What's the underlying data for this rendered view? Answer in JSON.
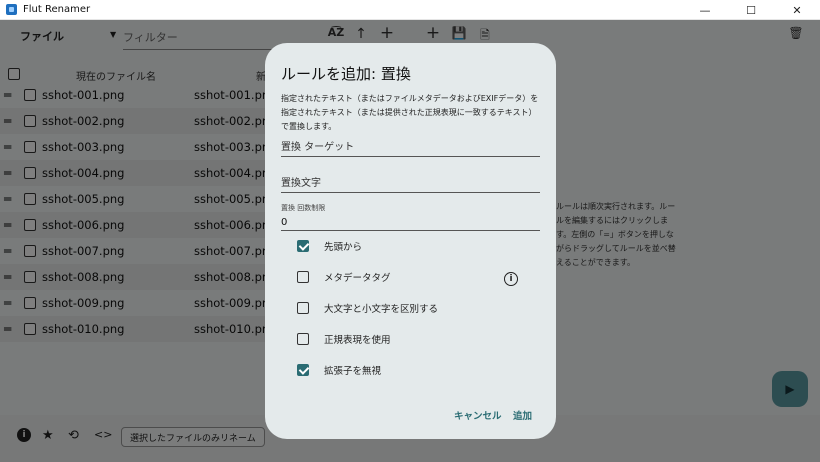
{
  "window": {
    "title": "Flut Renamer",
    "minimize": "—",
    "maximize": "☐",
    "close": "✕"
  },
  "toolbar": {
    "file_select": "ファイル",
    "filter_placeholder": "フィルター",
    "sort_az": "A͡Z",
    "arrow_up": "↑",
    "add": "+",
    "add_rule": "+",
    "save": "💾",
    "file_icon": "🗎",
    "delete": "🗑"
  },
  "list": {
    "header_current": "現在のファイル名",
    "header_new": "新",
    "rows": [
      {
        "current": "sshot-001.png",
        "new": "sshot-001.png"
      },
      {
        "current": "sshot-002.png",
        "new": "sshot-002.png"
      },
      {
        "current": "sshot-003.png",
        "new": "sshot-003.png"
      },
      {
        "current": "sshot-004.png",
        "new": "sshot-004.png"
      },
      {
        "current": "sshot-005.png",
        "new": "sshot-005.png"
      },
      {
        "current": "sshot-006.png",
        "new": "sshot-006.png"
      },
      {
        "current": "sshot-007.png",
        "new": "sshot-007.png"
      },
      {
        "current": "sshot-008.png",
        "new": "sshot-008.png"
      },
      {
        "current": "sshot-009.png",
        "new": "sshot-009.png"
      },
      {
        "current": "sshot-010.png",
        "new": "sshot-010.png"
      }
    ]
  },
  "rules_hint": "ルールは順次実行されます。ルールを編集するにはクリックします。左側の「=」ボタンを押しながらドラッグしてルールを並べ替えることができます。",
  "bottom": {
    "rename_selected": "選択したファイルのみリネーム",
    "info_icon": "i",
    "star_icon": "★",
    "history_icon": "⟲",
    "code_icon": "<>",
    "run_icon": "▶"
  },
  "dialog": {
    "title": "ルールを追加: 置換",
    "description": "指定されたテキスト（またはファイルメタデータおよびEXIFデータ）を指定されたテキスト（または提供された正規表現に一致するテキスト）で置換します。",
    "target_label": "置換 ターゲット",
    "replacement_label": "置換文字",
    "count_label": "置換 回数制限",
    "count_value": "0",
    "options": [
      {
        "label": "先頭から",
        "checked": true
      },
      {
        "label": "メタデータタグ",
        "checked": false
      },
      {
        "label": "大文字と小文字を区別する",
        "checked": false
      },
      {
        "label": "正規表現を使用",
        "checked": false
      },
      {
        "label": "拡張子を無視",
        "checked": true
      }
    ],
    "cancel": "キャンセル",
    "add": "追加"
  },
  "colors": {
    "accent": "#2a6c73",
    "fab": "#5a9aa3",
    "dialog_bg": "#e4eaeb"
  }
}
